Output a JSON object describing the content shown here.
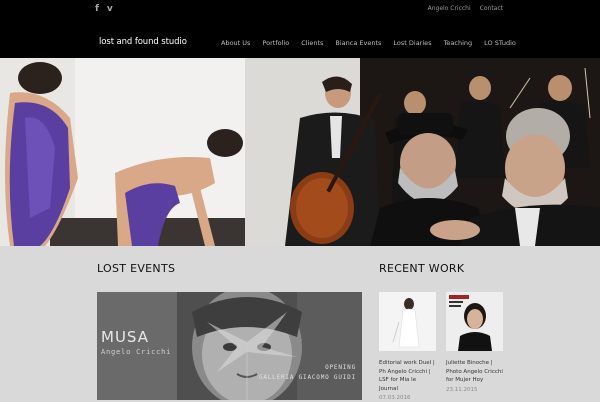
{
  "topbar": {
    "social": [
      {
        "icon": "facebook-icon",
        "glyph": "f"
      },
      {
        "icon": "vimeo-icon",
        "glyph": "v"
      }
    ],
    "links": [
      "Angelo Cricchi",
      "Contact"
    ]
  },
  "header": {
    "logo": "lost and found studio",
    "nav": [
      "About Us",
      "Portfolio",
      "Clients",
      "Bianca Events",
      "Lost Diaries",
      "Teaching",
      "LO STudio"
    ]
  },
  "lost_events": {
    "title": "LOST EVENTS",
    "feature": {
      "title": "MUSA",
      "subtitle": "Angelo Cricchi",
      "opening": "OPENING",
      "gallery": "GALLERIA GIACOMO GUIDI"
    }
  },
  "recent_work": {
    "title": "RECENT WORK",
    "items": [
      {
        "caption": "Editorial work Duel | Ph Angelo Cricchi | LSF for Mia le Journal",
        "date": "07.03.2016"
      },
      {
        "caption": "Juliette Binoche | Photo Angelo Cricchi for Mujer Hoy",
        "date": "23.11.2015"
      }
    ]
  }
}
